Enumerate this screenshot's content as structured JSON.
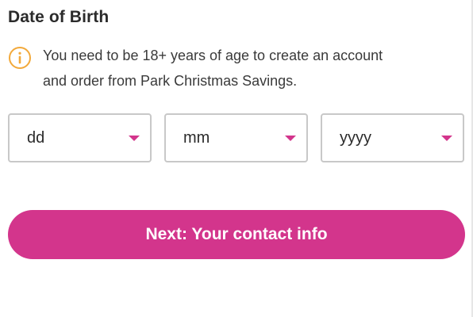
{
  "section": {
    "title": "Date of Birth"
  },
  "notice": {
    "icon": "info-icon",
    "icon_color": "#f2a93b",
    "line1": "You need to be 18+ years of age to create an account",
    "line2": "and order from Park Christmas Savings."
  },
  "dob": {
    "day": {
      "value": "dd"
    },
    "month": {
      "value": "mm"
    },
    "year": {
      "value": "yyyy"
    },
    "caret_icon": "caret-down-icon",
    "caret_color": "#d3358c"
  },
  "actions": {
    "next_label": "Next: Your contact info",
    "next_color": "#d3358c"
  }
}
